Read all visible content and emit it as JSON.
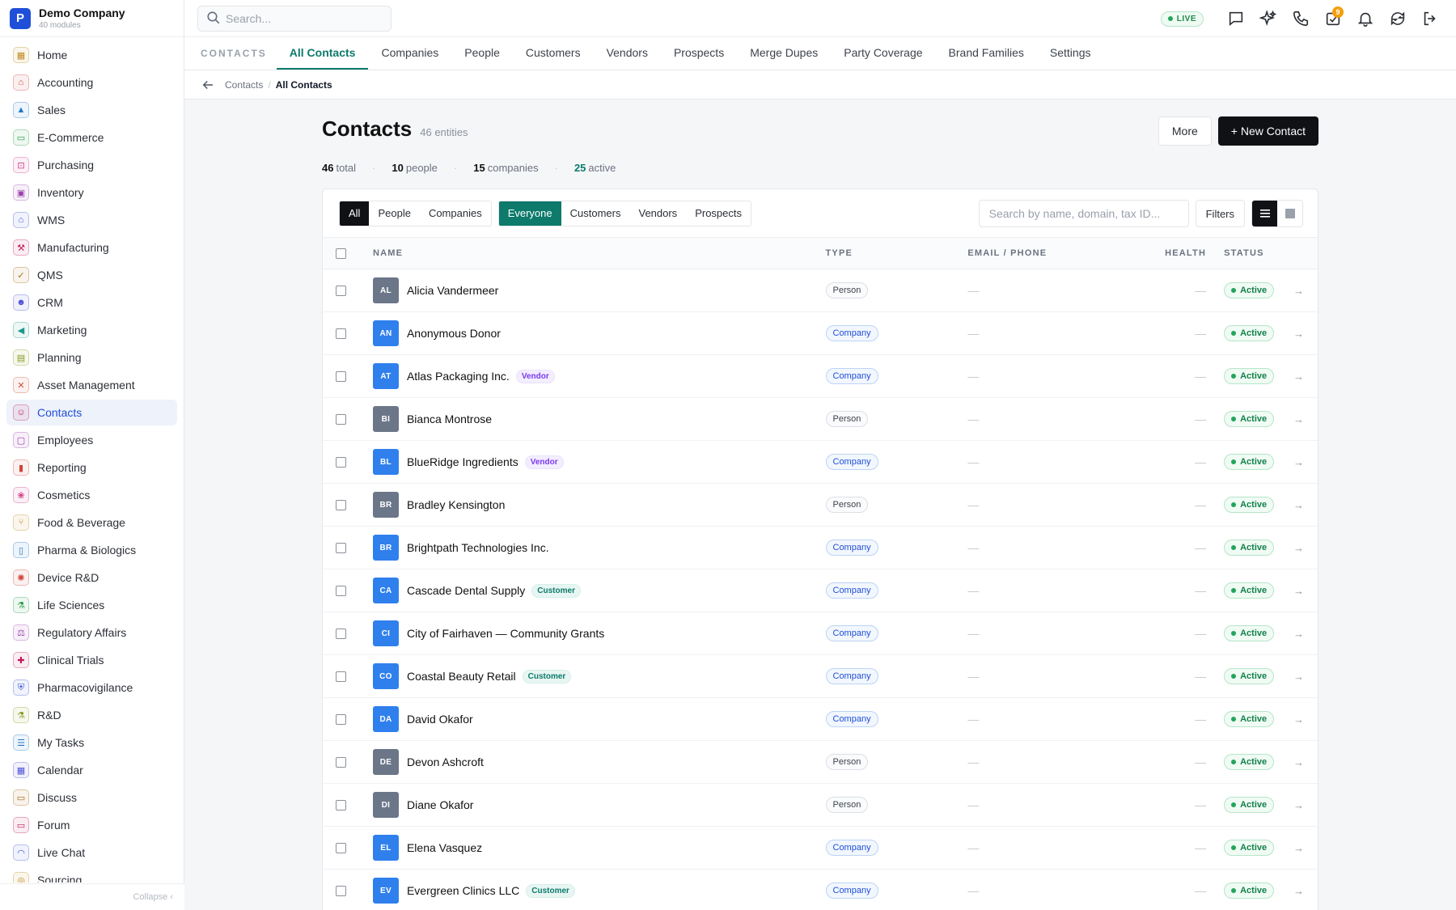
{
  "brand": {
    "logo": "P",
    "name": "Demo Company",
    "sub": "40 modules"
  },
  "sidebar": {
    "collapse_label": "Collapse ‹",
    "items": [
      {
        "label": "Home",
        "icon": "grid-icon",
        "glyph": "▦",
        "color": "#c08a1e"
      },
      {
        "label": "Accounting",
        "icon": "bank-icon",
        "glyph": "⌂",
        "color": "#d0443a"
      },
      {
        "label": "Sales",
        "icon": "flask-icon",
        "glyph": "▲",
        "color": "#1f78c8"
      },
      {
        "label": "E-Commerce",
        "icon": "store-icon",
        "glyph": "▭",
        "color": "#2a9d4a"
      },
      {
        "label": "Purchasing",
        "icon": "cart-icon",
        "glyph": "⊡",
        "color": "#d23a8a"
      },
      {
        "label": "Inventory",
        "icon": "box-icon",
        "glyph": "▣",
        "color": "#9c3fb0"
      },
      {
        "label": "WMS",
        "icon": "warehouse-icon",
        "glyph": "⌂",
        "color": "#3b5bd6"
      },
      {
        "label": "Manufacturing",
        "icon": "factory-icon",
        "glyph": "⚒",
        "color": "#c2185b"
      },
      {
        "label": "QMS",
        "icon": "check-circle-icon",
        "glyph": "✓",
        "color": "#a86a12"
      },
      {
        "label": "CRM",
        "icon": "users-icon",
        "glyph": "☻",
        "color": "#4b4fd6"
      },
      {
        "label": "Marketing",
        "icon": "megaphone-icon",
        "glyph": "◀",
        "color": "#1a9a8a"
      },
      {
        "label": "Planning",
        "icon": "calendar-plan-icon",
        "glyph": "▤",
        "color": "#8a9a1e"
      },
      {
        "label": "Asset Management",
        "icon": "tools-icon",
        "glyph": "✕",
        "color": "#d0503a"
      },
      {
        "label": "Contacts",
        "icon": "contact-card-icon",
        "glyph": "☺",
        "color": "#c2185b",
        "active": true
      },
      {
        "label": "Employees",
        "icon": "briefcase-icon",
        "glyph": "▢",
        "color": "#9c3fb0"
      },
      {
        "label": "Reporting",
        "icon": "bar-chart-icon",
        "glyph": "▮",
        "color": "#d0443a"
      },
      {
        "label": "Cosmetics",
        "icon": "lotus-icon",
        "glyph": "❀",
        "color": "#d23a8a"
      },
      {
        "label": "Food & Beverage",
        "icon": "fork-knife-icon",
        "glyph": "⑂",
        "color": "#c08a1e"
      },
      {
        "label": "Pharma & Biologics",
        "icon": "pill-icon",
        "glyph": "▯",
        "color": "#1f78c8"
      },
      {
        "label": "Device R&D",
        "icon": "chip-icon",
        "glyph": "✺",
        "color": "#d0443a"
      },
      {
        "label": "Life Sciences",
        "icon": "microscope-icon",
        "glyph": "⚗",
        "color": "#2a9d4a"
      },
      {
        "label": "Regulatory Affairs",
        "icon": "gavel-icon",
        "glyph": "⚖",
        "color": "#9c3fb0"
      },
      {
        "label": "Clinical Trials",
        "icon": "clipboard-icon",
        "glyph": "✚",
        "color": "#c2185b"
      },
      {
        "label": "Pharmacovigilance",
        "icon": "shield-icon",
        "glyph": "⛨",
        "color": "#3b5bd6"
      },
      {
        "label": "R&D",
        "icon": "beaker-icon",
        "glyph": "⚗",
        "color": "#8a9a1e"
      },
      {
        "label": "My Tasks",
        "icon": "checklist-icon",
        "glyph": "☰",
        "color": "#1f78c8"
      },
      {
        "label": "Calendar",
        "icon": "calendar-icon",
        "glyph": "▦",
        "color": "#4b4fd6"
      },
      {
        "label": "Discuss",
        "icon": "chat-icon",
        "glyph": "▭",
        "color": "#a86a12"
      },
      {
        "label": "Forum",
        "icon": "forum-icon",
        "glyph": "▭",
        "color": "#c2185b"
      },
      {
        "label": "Live Chat",
        "icon": "headset-icon",
        "glyph": "◠",
        "color": "#3b5bd6"
      },
      {
        "label": "Sourcing",
        "icon": "globe-icon",
        "glyph": "◎",
        "color": "#c08a1e"
      }
    ]
  },
  "topbar": {
    "search_placeholder": "Search...",
    "live_label": "LIVE",
    "notif_count": "9"
  },
  "modtabs": {
    "label": "CONTACTS",
    "tabs": [
      {
        "label": "All Contacts",
        "active": true
      },
      {
        "label": "Companies"
      },
      {
        "label": "People"
      },
      {
        "label": "Customers"
      },
      {
        "label": "Vendors"
      },
      {
        "label": "Prospects"
      },
      {
        "label": "Merge Dupes"
      },
      {
        "label": "Party Coverage"
      },
      {
        "label": "Brand Families"
      },
      {
        "label": "Settings"
      }
    ]
  },
  "breadcrumb": {
    "parent": "Contacts",
    "sep": "/",
    "current": "All Contacts"
  },
  "header": {
    "title": "Contacts",
    "subtitle": "46 entities",
    "more_label": "More",
    "new_label": "+ New Contact"
  },
  "stats": [
    {
      "value": "46",
      "label": "total"
    },
    {
      "value": "10",
      "label": "people"
    },
    {
      "value": "15",
      "label": "companies"
    },
    {
      "value": "25",
      "label": "active",
      "green": true
    }
  ],
  "toolbar": {
    "kind_filters": [
      "All",
      "People",
      "Companies"
    ],
    "role_filters": [
      "Everyone",
      "Customers",
      "Vendors",
      "Prospects"
    ],
    "search_placeholder": "Search by name, domain, tax ID...",
    "filters_label": "Filters"
  },
  "table": {
    "columns": {
      "name": "NAME",
      "type": "TYPE",
      "email": "EMAIL / PHONE",
      "health": "HEALTH",
      "status": "STATUS"
    },
    "empty": "—",
    "arrow": "→",
    "rows": [
      {
        "initials": "AL",
        "name": "Alicia Vandermeer",
        "kind": "person",
        "type": "Person",
        "status": "Active"
      },
      {
        "initials": "AN",
        "name": "Anonymous Donor",
        "kind": "company",
        "type": "Company",
        "status": "Active"
      },
      {
        "initials": "AT",
        "name": "Atlas Packaging Inc.",
        "kind": "company",
        "type": "Company",
        "tag": "Vendor",
        "status": "Active"
      },
      {
        "initials": "BI",
        "name": "Bianca Montrose",
        "kind": "person",
        "type": "Person",
        "status": "Active"
      },
      {
        "initials": "BL",
        "name": "BlueRidge Ingredients",
        "kind": "company",
        "type": "Company",
        "tag": "Vendor",
        "status": "Active"
      },
      {
        "initials": "BR",
        "name": "Bradley Kensington",
        "kind": "person",
        "type": "Person",
        "status": "Active"
      },
      {
        "initials": "BR",
        "name": "Brightpath Technologies Inc.",
        "kind": "company",
        "type": "Company",
        "status": "Active"
      },
      {
        "initials": "CA",
        "name": "Cascade Dental Supply",
        "kind": "company",
        "type": "Company",
        "tag": "Customer",
        "status": "Active"
      },
      {
        "initials": "CI",
        "name": "City of Fairhaven — Community Grants",
        "kind": "company",
        "type": "Company",
        "status": "Active"
      },
      {
        "initials": "CO",
        "name": "Coastal Beauty Retail",
        "kind": "company",
        "type": "Company",
        "tag": "Customer",
        "status": "Active"
      },
      {
        "initials": "DA",
        "name": "David Okafor",
        "kind": "company",
        "type": "Company",
        "status": "Active"
      },
      {
        "initials": "DE",
        "name": "Devon Ashcroft",
        "kind": "person",
        "type": "Person",
        "status": "Active"
      },
      {
        "initials": "DI",
        "name": "Diane Okafor",
        "kind": "person",
        "type": "Person",
        "status": "Active"
      },
      {
        "initials": "EL",
        "name": "Elena Vasquez",
        "kind": "company",
        "type": "Company",
        "status": "Active"
      },
      {
        "initials": "EV",
        "name": "Evergreen Clinics LLC",
        "kind": "company",
        "type": "Company",
        "tag": "Customer",
        "status": "Active"
      }
    ]
  }
}
